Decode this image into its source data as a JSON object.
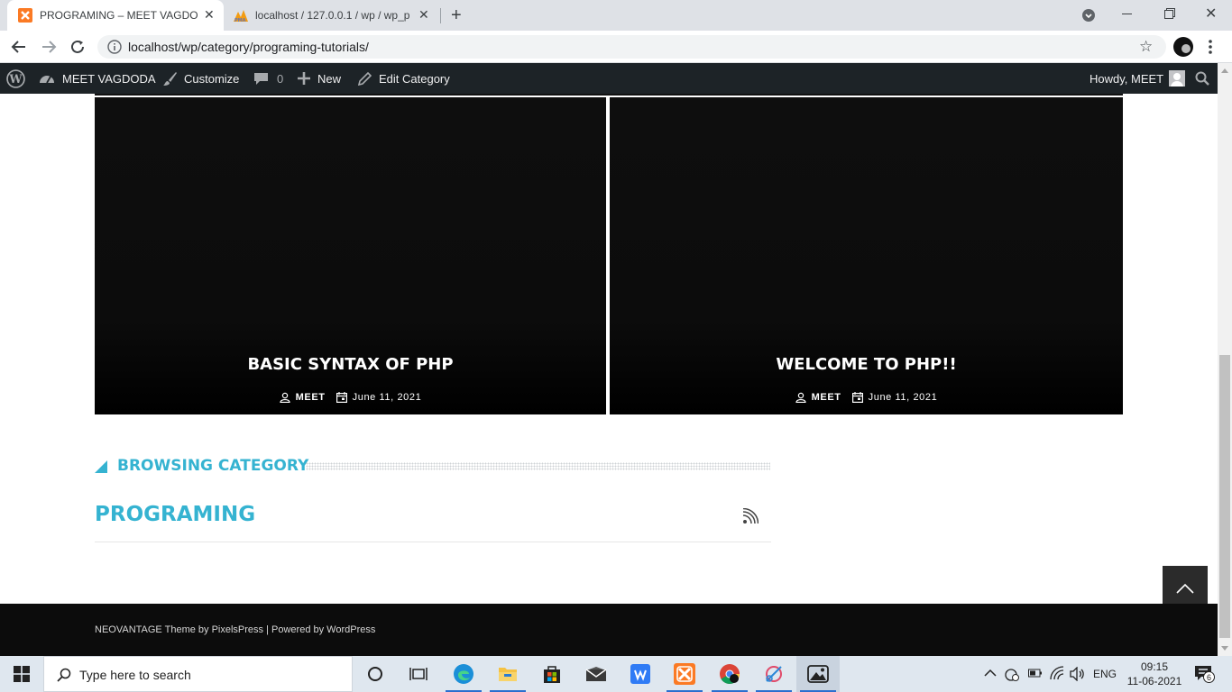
{
  "browser": {
    "tabs": [
      {
        "title": "PROGRAMING – MEET VAGDODA",
        "active": true
      },
      {
        "title": "localhost / 127.0.0.1 / wp / wp_p",
        "active": false
      }
    ],
    "address": "localhost/wp/category/programing-tutorials/"
  },
  "adminbar": {
    "site": "MEET VAGDODA",
    "customize": "Customize",
    "comments": "0",
    "new": "New",
    "edit": "Edit Category",
    "howdy": "Howdy, MEET"
  },
  "posts": [
    {
      "title": "BASIC SYNTAX OF PHP",
      "author": "MEET",
      "date": "June 11, 2021"
    },
    {
      "title": "WELCOME TO PHP!!",
      "author": "MEET",
      "date": "June 11, 2021"
    }
  ],
  "section": {
    "heading": "BROWSING CATEGORY",
    "category": "PROGRAMING"
  },
  "footer": {
    "text": "NEOVANTAGE Theme by PixelsPress | Powered by WordPress"
  },
  "taskbar": {
    "search_placeholder": "Type here to search",
    "lang": "ENG",
    "time": "09:15",
    "date": "11-06-2021",
    "notifications": "6"
  },
  "colors": {
    "accent": "#35b3d1",
    "adminbar": "#1d2327",
    "footer": "#0c0c0c"
  }
}
